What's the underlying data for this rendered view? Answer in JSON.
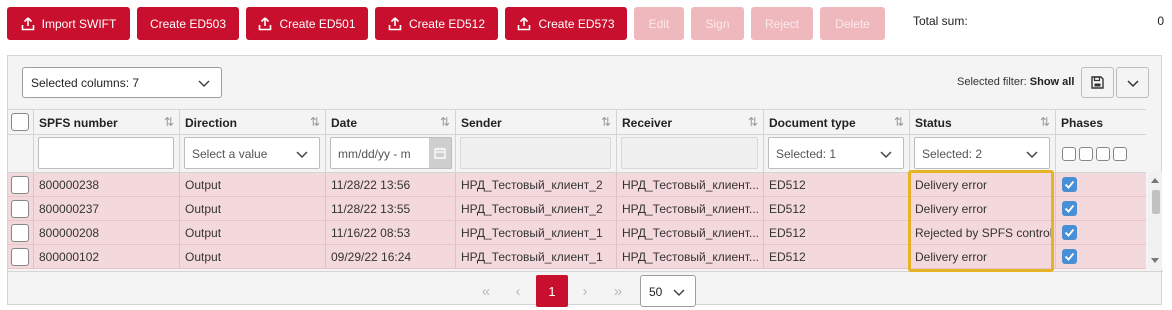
{
  "toolbar": {
    "buttons": [
      {
        "label": "Import SWIFT",
        "icon": "upload-icon",
        "enabled": true
      },
      {
        "label": "Create ED503",
        "icon": "",
        "enabled": true
      },
      {
        "label": "Create ED501",
        "icon": "upload-icon",
        "enabled": true
      },
      {
        "label": "Create ED512",
        "icon": "upload-icon",
        "enabled": true
      },
      {
        "label": "Create ED573",
        "icon": "upload-icon",
        "enabled": true
      },
      {
        "label": "Edit",
        "enabled": false
      },
      {
        "label": "Sign",
        "enabled": false
      },
      {
        "label": "Reject",
        "enabled": false
      },
      {
        "label": "Delete",
        "enabled": false
      }
    ],
    "total_label": "Total sum:",
    "total_value": "0"
  },
  "panel": {
    "columns_select": "Selected columns: 7",
    "filter_label": "Selected filter:",
    "filter_value": "Show all",
    "save_icon": "save-icon",
    "expand_icon": "chevron-down-icon"
  },
  "table": {
    "headers": [
      "SPFS number",
      "Direction",
      "Date",
      "Sender",
      "Receiver",
      "Document type",
      "Status",
      "Phases"
    ],
    "filters": {
      "direction_placeholder": "Select a value",
      "date_placeholder": "mm/dd/yy - m",
      "doctype": "Selected: 1",
      "status": "Selected: 2"
    },
    "rows": [
      {
        "spfs": "800000238",
        "direction": "Output",
        "date": "11/28/22 13:56",
        "sender": "НРД_Тестовый_клиент_2",
        "receiver": "НРД_Тестовый_клиент...",
        "doctype": "ED512",
        "status": "Delivery error"
      },
      {
        "spfs": "800000237",
        "direction": "Output",
        "date": "11/28/22 13:55",
        "sender": "НРД_Тестовый_клиент_2",
        "receiver": "НРД_Тестовый_клиент...",
        "doctype": "ED512",
        "status": "Delivery error"
      },
      {
        "spfs": "800000208",
        "direction": "Output",
        "date": "11/16/22 08:53",
        "sender": "НРД_Тестовый_клиент_1",
        "receiver": "НРД_Тестовый_клиент...",
        "doctype": "ED512",
        "status": "Rejected by SPFS control"
      },
      {
        "spfs": "800000102",
        "direction": "Output",
        "date": "09/29/22 16:24",
        "sender": "НРД_Тестовый_клиент_1",
        "receiver": "НРД_Тестовый_клиент...",
        "doctype": "ED512",
        "status": "Delivery error"
      }
    ]
  },
  "pagination": {
    "first": "«",
    "prev": "‹",
    "current": "1",
    "next": "›",
    "last": "»",
    "page_size": "50"
  },
  "colors": {
    "accent": "#c8102e",
    "accent_disabled": "#efb8bd",
    "row_highlight": "#f4d9dc",
    "checkbox_checked": "#4a8fd6",
    "callout": "#e6b325"
  }
}
